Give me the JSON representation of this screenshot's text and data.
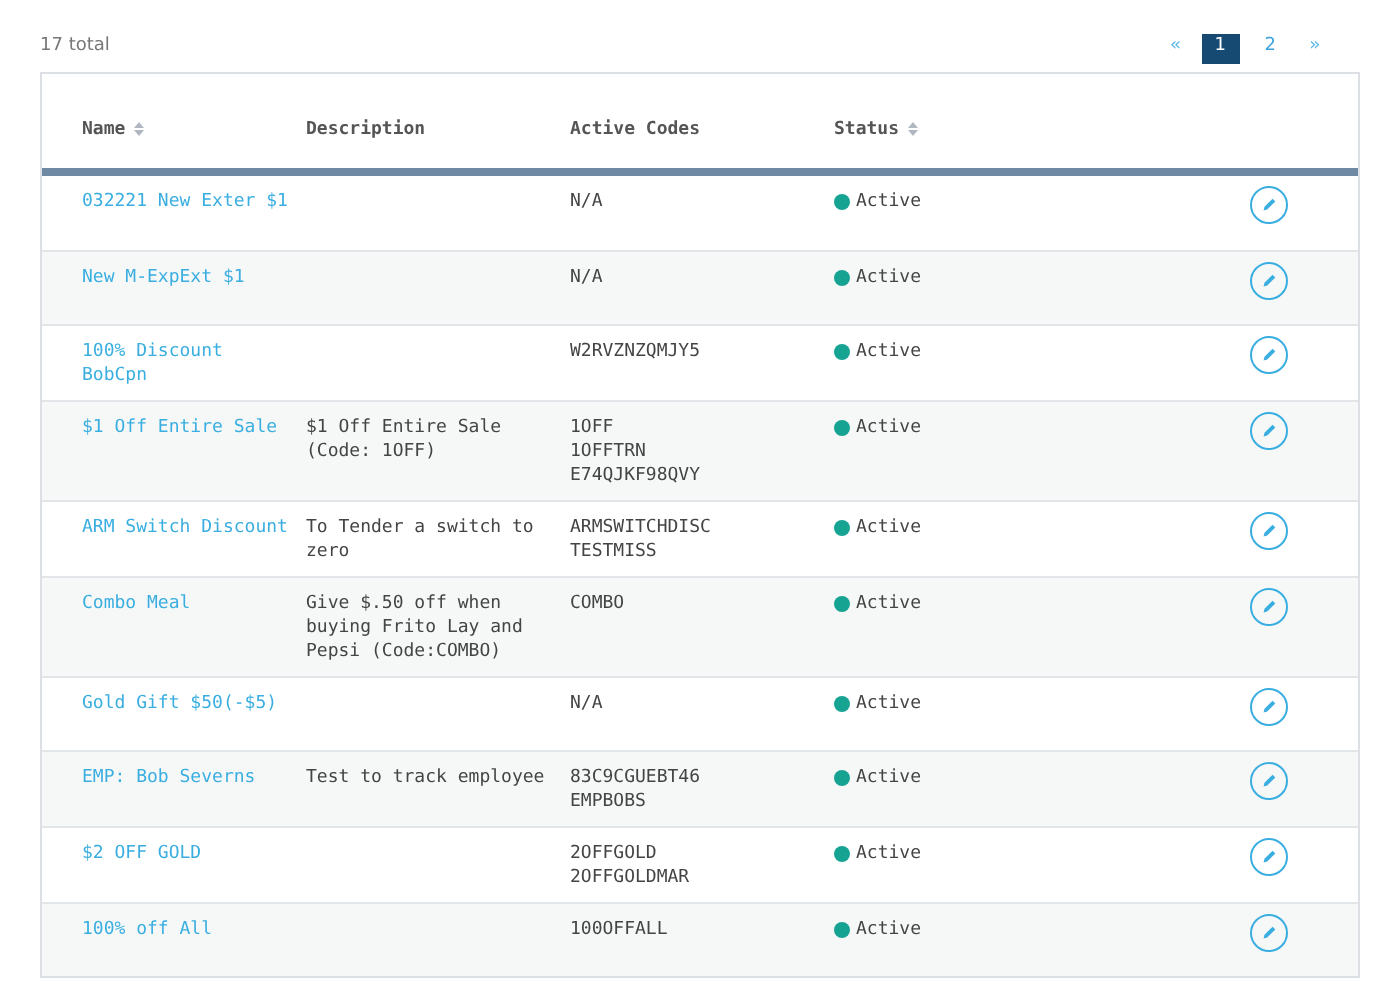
{
  "total": "17 total",
  "pagination": {
    "prev": "«",
    "next": "»",
    "pages": [
      {
        "label": "1",
        "selected": true
      },
      {
        "label": "2",
        "selected": false
      }
    ]
  },
  "table": {
    "columns": [
      {
        "label": "Name",
        "sortable": true
      },
      {
        "label": "Description",
        "sortable": false
      },
      {
        "label": "Active Codes",
        "sortable": false
      },
      {
        "label": "Status",
        "sortable": true
      }
    ],
    "rows": [
      {
        "name": "032221 New Exter $1",
        "codes": [
          "N/A"
        ],
        "status": "Active"
      },
      {
        "name": "New M-ExpExt $1",
        "codes": [
          "N/A"
        ],
        "status": "Active"
      },
      {
        "name": "100% Discount BobCpn",
        "codes": [
          "W2RVZNZQMJY5"
        ],
        "status": "Active"
      },
      {
        "name": "$1 Off Entire Sale",
        "description": "$1 Off Entire Sale (Code: 1OFF)",
        "codes": [
          "1OFF",
          "1OFFTRN",
          "E74QJKF98QVY"
        ],
        "status": "Active"
      },
      {
        "name": "ARM Switch Discount",
        "description": "To Tender a switch to zero",
        "codes": [
          "ARMSWITCHDISC",
          "TESTMISS"
        ],
        "status": "Active"
      },
      {
        "name": "Combo Meal",
        "description": "Give $.50 off when buying Frito Lay and Pepsi (Code:COMBO)",
        "codes": [
          "COMBO"
        ],
        "status": "Active"
      },
      {
        "name": "Gold Gift $50(-$5)",
        "codes": [
          "N/A"
        ],
        "status": "Active"
      },
      {
        "name": "EMP: Bob Severns",
        "description": "Test to track employee",
        "codes": [
          "83C9CGUEBT46",
          "EMPBOBS"
        ],
        "status": "Active"
      },
      {
        "name": "$2 OFF GOLD",
        "codes": [
          "2OFFGOLD",
          "2OFFGOLDMAR"
        ],
        "status": "Active"
      },
      {
        "name": "100% off All",
        "codes": [
          "100OFFALL"
        ],
        "status": "Active"
      }
    ]
  }
}
